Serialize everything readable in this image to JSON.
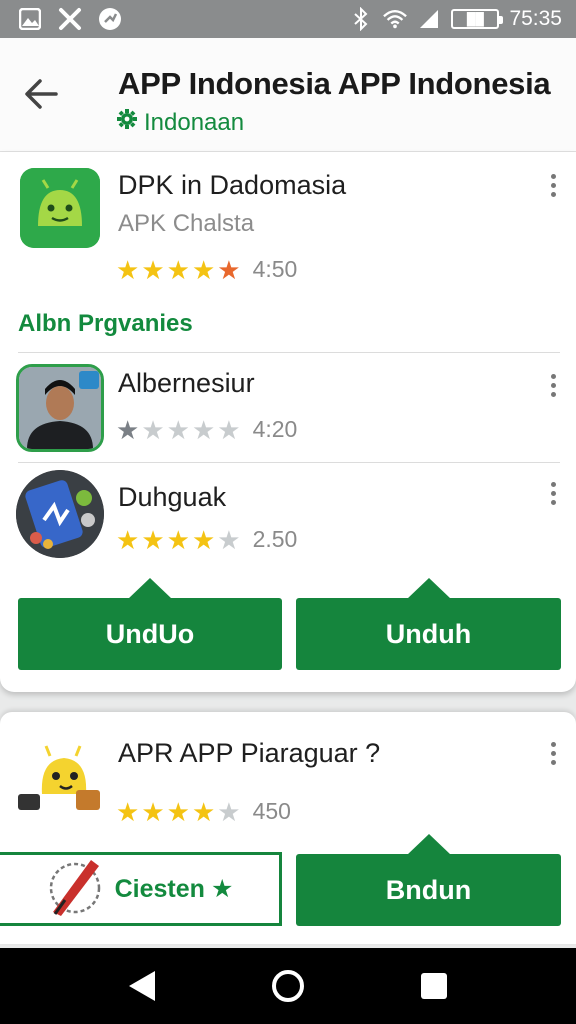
{
  "status_bar": {
    "time": "75:35",
    "battery": "██"
  },
  "header": {
    "title": "APP Indonesia APP Indonesia",
    "subtitle": "Indonaan"
  },
  "featured_app": {
    "name": "DPK in Dadomasia",
    "developer": "APK Chalsta",
    "rating": 4.5,
    "score": "4:50"
  },
  "section": {
    "title": "Albn Prgvanies"
  },
  "apps": [
    {
      "name": "Albernesiur",
      "rating": 1,
      "score": "4:20"
    },
    {
      "name": "Duhguak",
      "rating": 4,
      "score": "2.50"
    }
  ],
  "buttons": {
    "left": "UndUo",
    "right": "Unduh"
  },
  "card2": {
    "name": "APR APP Piaraguar ?",
    "rating": 4,
    "score": "450",
    "outline_button": "Ciesten",
    "outline_star": "★",
    "primary_button": "Bndun"
  },
  "colors": {
    "accent": "#15853d",
    "star": "#f4c313"
  }
}
